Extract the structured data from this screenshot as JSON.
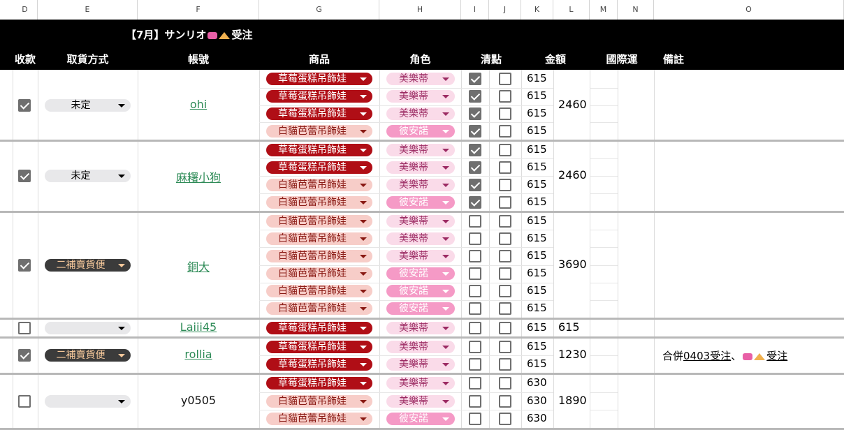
{
  "columns": [
    "D",
    "E",
    "F",
    "G",
    "H",
    "I",
    "J",
    "K",
    "L",
    "M",
    "N",
    "O"
  ],
  "title": "【7月】サンリオ",
  "title_suffix": "受注",
  "headers": {
    "payment": "收款",
    "pickup": "取貨方式",
    "account": "帳號",
    "product": "商品",
    "character": "角色",
    "check": "清點",
    "amount": "金額",
    "intl_shipping": "國際運",
    "remarks": "備註"
  },
  "orders": [
    {
      "paid": true,
      "pickup": "未定",
      "account": "ohi",
      "account_link": true,
      "total": "2460",
      "items": [
        {
          "product": "草莓蛋糕吊飾娃",
          "product_style": "red",
          "character": "美樂蒂",
          "character_style": "light",
          "i": true,
          "j": false,
          "amount": "615"
        },
        {
          "product": "草莓蛋糕吊飾娃",
          "product_style": "red",
          "character": "美樂蒂",
          "character_style": "light",
          "i": true,
          "j": false,
          "amount": "615"
        },
        {
          "product": "草莓蛋糕吊飾娃",
          "product_style": "red",
          "character": "美樂蒂",
          "character_style": "light",
          "i": true,
          "j": false,
          "amount": "615"
        },
        {
          "product": "白貓芭蕾吊飾娃",
          "product_style": "pink",
          "character": "彼安諾",
          "character_style": "hot",
          "i": true,
          "j": false,
          "amount": "615"
        }
      ]
    },
    {
      "paid": true,
      "pickup": "未定",
      "account": "麻糬小狗",
      "account_link": true,
      "total": "2460",
      "items": [
        {
          "product": "草莓蛋糕吊飾娃",
          "product_style": "red",
          "character": "美樂蒂",
          "character_style": "light",
          "i": true,
          "j": false,
          "amount": "615"
        },
        {
          "product": "草莓蛋糕吊飾娃",
          "product_style": "red",
          "character": "美樂蒂",
          "character_style": "light",
          "i": true,
          "j": false,
          "amount": "615"
        },
        {
          "product": "白貓芭蕾吊飾娃",
          "product_style": "pink",
          "character": "美樂蒂",
          "character_style": "light",
          "i": true,
          "j": false,
          "amount": "615"
        },
        {
          "product": "白貓芭蕾吊飾娃",
          "product_style": "pink",
          "character": "彼安諾",
          "character_style": "hot",
          "i": true,
          "j": false,
          "amount": "615"
        }
      ]
    },
    {
      "paid": true,
      "pickup": "二補賣貨便",
      "account": "銅大",
      "account_link": true,
      "total": "3690",
      "items": [
        {
          "product": "白貓芭蕾吊飾娃",
          "product_style": "pink",
          "character": "美樂蒂",
          "character_style": "light",
          "i": false,
          "j": false,
          "amount": "615"
        },
        {
          "product": "白貓芭蕾吊飾娃",
          "product_style": "pink",
          "character": "美樂蒂",
          "character_style": "light",
          "i": false,
          "j": false,
          "amount": "615"
        },
        {
          "product": "白貓芭蕾吊飾娃",
          "product_style": "pink",
          "character": "美樂蒂",
          "character_style": "light",
          "i": false,
          "j": false,
          "amount": "615"
        },
        {
          "product": "白貓芭蕾吊飾娃",
          "product_style": "pink",
          "character": "彼安諾",
          "character_style": "hot",
          "i": false,
          "j": false,
          "amount": "615"
        },
        {
          "product": "白貓芭蕾吊飾娃",
          "product_style": "pink",
          "character": "彼安諾",
          "character_style": "hot",
          "i": false,
          "j": false,
          "amount": "615"
        },
        {
          "product": "白貓芭蕾吊飾娃",
          "product_style": "pink",
          "character": "彼安諾",
          "character_style": "hot",
          "i": false,
          "j": false,
          "amount": "615"
        }
      ]
    },
    {
      "paid": false,
      "pickup": "",
      "account": "Laiii45",
      "account_link": true,
      "total": "615",
      "items": [
        {
          "product": "草莓蛋糕吊飾娃",
          "product_style": "red",
          "character": "美樂蒂",
          "character_style": "light",
          "i": false,
          "j": false,
          "amount": "615"
        }
      ]
    },
    {
      "paid": true,
      "pickup": "二補賣貨便",
      "account": "rollia",
      "account_link": true,
      "total": "1230",
      "remark_prefix": "合併",
      "remark_ref": "0403受注",
      "remark_mid": "、",
      "remark_suffix": "受注",
      "items": [
        {
          "product": "草莓蛋糕吊飾娃",
          "product_style": "red",
          "character": "美樂蒂",
          "character_style": "light",
          "i": false,
          "j": false,
          "amount": "615"
        },
        {
          "product": "草莓蛋糕吊飾娃",
          "product_style": "red",
          "character": "美樂蒂",
          "character_style": "light",
          "i": false,
          "j": false,
          "amount": "615"
        }
      ]
    },
    {
      "paid": false,
      "pickup": "",
      "account": "y0505",
      "account_link": false,
      "total": "1890",
      "items": [
        {
          "product": "草莓蛋糕吊飾娃",
          "product_style": "red",
          "character": "美樂蒂",
          "character_style": "light",
          "i": false,
          "j": false,
          "amount": "630"
        },
        {
          "product": "白貓芭蕾吊飾娃",
          "product_style": "pink",
          "character": "美樂蒂",
          "character_style": "light",
          "i": false,
          "j": false,
          "amount": "630"
        },
        {
          "product": "白貓芭蕾吊飾娃",
          "product_style": "pink",
          "character": "彼安諾",
          "character_style": "hot",
          "i": false,
          "j": false,
          "amount": "630"
        }
      ]
    }
  ],
  "colors": {
    "header_band": "#000000",
    "product_red": "#b00e16",
    "product_pink": "#f7cdc8",
    "character_light": "#fadbe9",
    "character_hot": "#f59ac6",
    "account_link": "#2e8b57"
  }
}
